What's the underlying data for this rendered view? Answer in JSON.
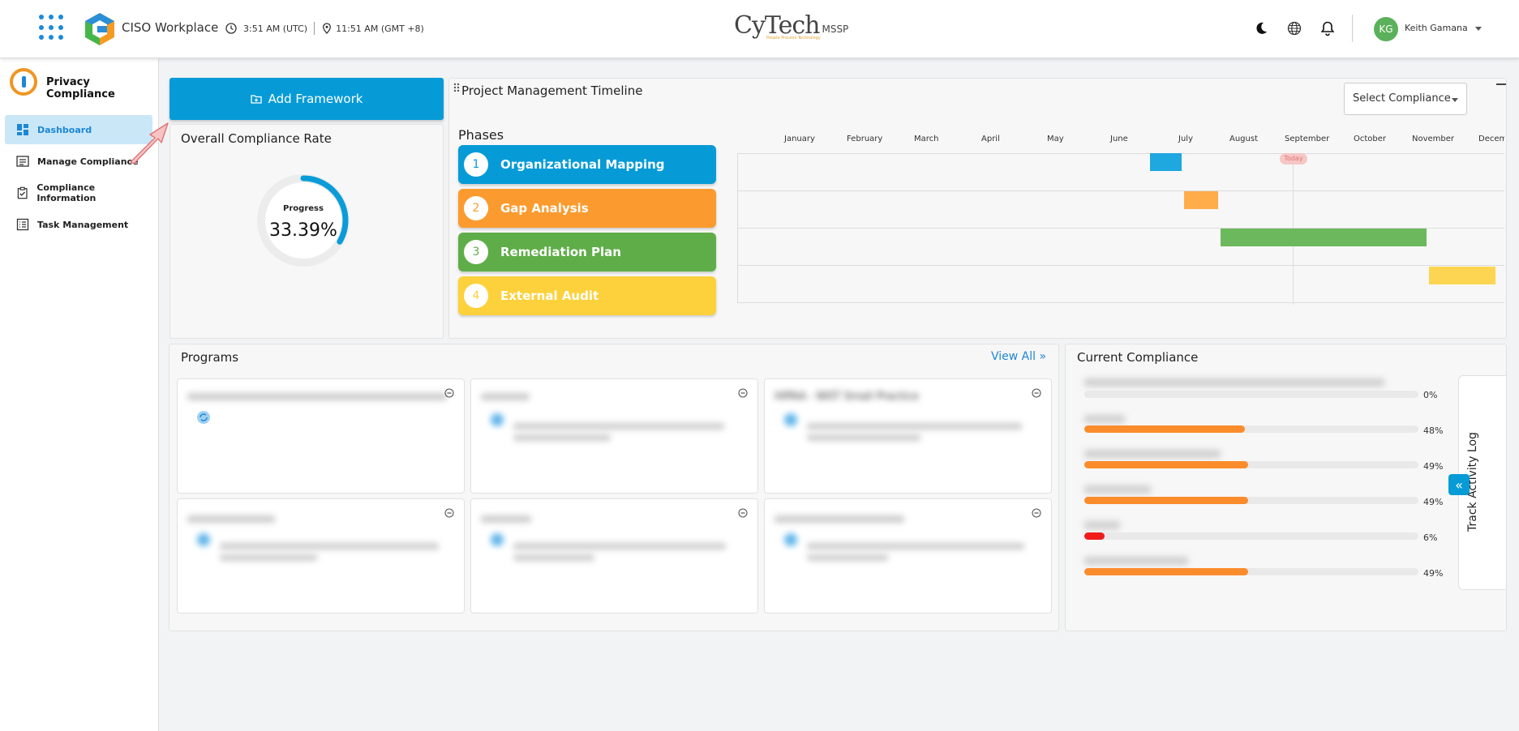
{
  "header": {
    "app_title": "CISO Workplace",
    "time_utc": "3:51 AM (UTC)",
    "time_local": "11:51 AM (GMT +8)",
    "center_logo_main": "CyTech",
    "center_logo_suffix": "MSSP",
    "center_logo_tagline": "People Process Technology",
    "user": {
      "initials": "KG",
      "name": "Keith Gamana"
    },
    "icons": [
      "apps-grid-icon",
      "clock-icon",
      "location-pin-icon",
      "moon-icon",
      "globe-icon",
      "bell-icon",
      "chevron-down-icon"
    ]
  },
  "sidebar": {
    "module_title": "Privacy Compliance",
    "collapse_glyph": "‹",
    "items": [
      {
        "label": "Dashboard",
        "icon": "dashboard-icon",
        "active": true
      },
      {
        "label": "Manage Compliance",
        "icon": "list-icon",
        "active": false
      },
      {
        "label": "Compliance Information",
        "icon": "clipboard-check-icon",
        "active": false
      },
      {
        "label": "Task Management",
        "icon": "checklist-icon",
        "active": false
      }
    ]
  },
  "framework": {
    "add_button_label": "Add Framework",
    "overall_title": "Overall Compliance Rate",
    "progress_label": "Progress",
    "progress_value": "33.39%",
    "progress_fraction": 0.3339,
    "ring_color": "#0a9cd8"
  },
  "timeline": {
    "title": "Project Management Timeline",
    "select_placeholder": "Select Compliance",
    "phases_title": "Phases",
    "phases": [
      {
        "num": "1",
        "label": "Organizational Mapping",
        "color": "#069bd7"
      },
      {
        "num": "2",
        "label": "Gap Analysis",
        "color": "#fb9b2f"
      },
      {
        "num": "3",
        "label": "Remediation Plan",
        "color": "#5fad48"
      },
      {
        "num": "4",
        "label": "External Audit",
        "color": "#fdd13b"
      }
    ],
    "months": [
      "January",
      "February",
      "March",
      "April",
      "May",
      "June",
      "July",
      "August",
      "September",
      "October",
      "November",
      "December"
    ],
    "months_visible": [
      "January",
      "February",
      "March",
      "April",
      "May",
      "June",
      "July",
      "August",
      "September",
      "October",
      "November",
      "Decem"
    ],
    "today_label": "Today"
  },
  "programs": {
    "title": "Programs",
    "view_all_label": "View All",
    "view_all_glyph": "»",
    "visible_partial_title": "HIPAA - NIST Small Practice"
  },
  "current_compliance": {
    "title": "Current Compliance",
    "rows": [
      {
        "percent": "0%",
        "value": 0,
        "color": "#fb8c2b"
      },
      {
        "percent": "48%",
        "value": 0.48,
        "color": "#fb8c2b"
      },
      {
        "percent": "49%",
        "value": 0.49,
        "color": "#fb8c2b"
      },
      {
        "percent": "49%",
        "value": 0.49,
        "color": "#fb8c2b"
      },
      {
        "percent": "6%",
        "value": 0.06,
        "color": "#f01c1c"
      },
      {
        "percent": "49%",
        "value": 0.49,
        "color": "#fb8c2b"
      }
    ]
  },
  "track_activity": {
    "label": "Track Activity Log",
    "glyph": "«"
  }
}
